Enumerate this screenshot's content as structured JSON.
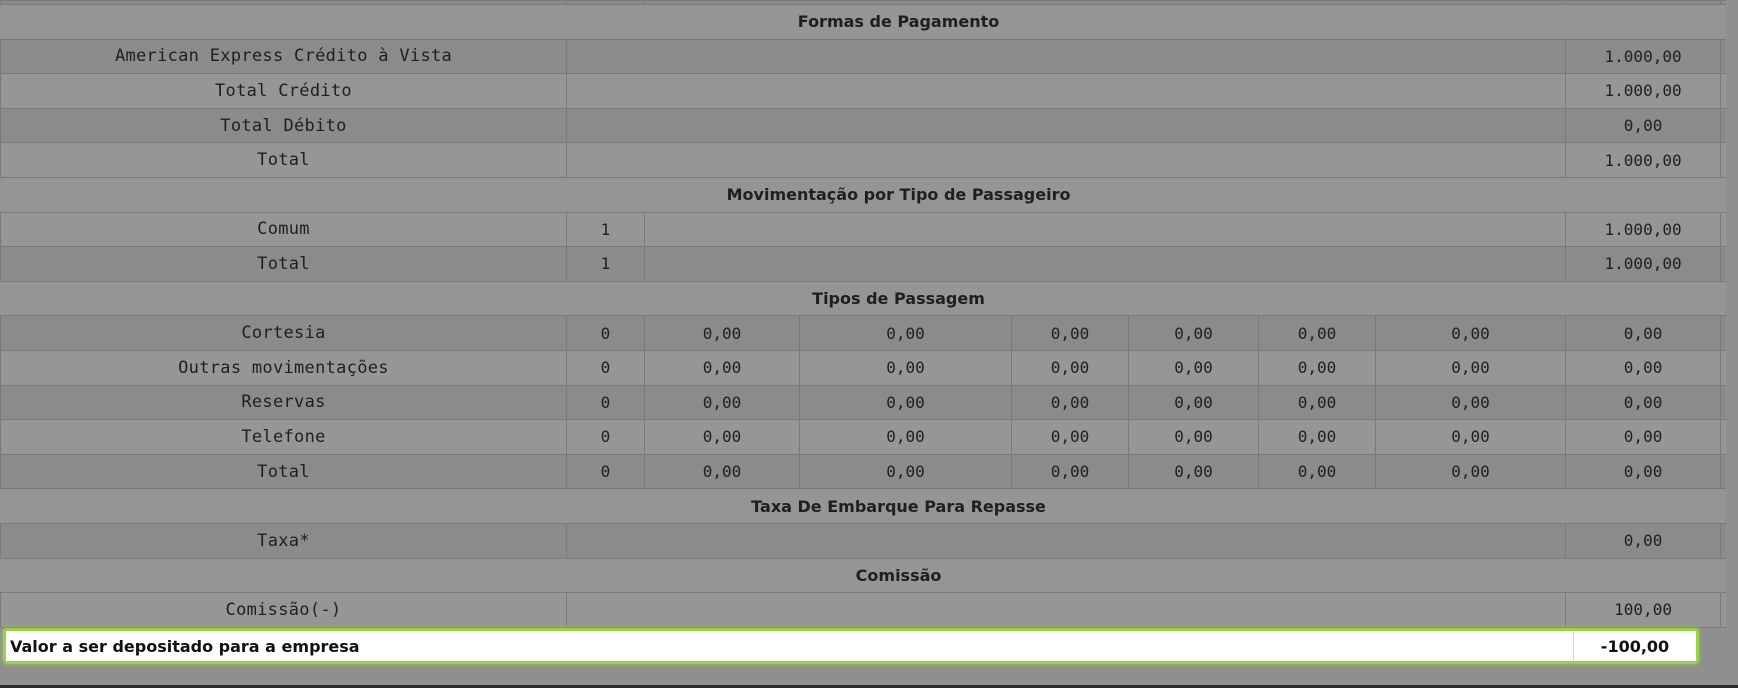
{
  "sections": {
    "pagamento": {
      "title": "Formas de Pagamento",
      "rows": [
        {
          "label": "American Express Crédito à Vista",
          "total": "1.000,00"
        },
        {
          "label": "Total Crédito",
          "total": "1.000,00"
        },
        {
          "label": "Total Débito",
          "total": "0,00"
        },
        {
          "label": "Total",
          "total": "1.000,00"
        }
      ]
    },
    "passageiro": {
      "title": "Movimentação por Tipo de Passageiro",
      "rows": [
        {
          "label": "Comum",
          "qty": "1",
          "total": "1.000,00"
        },
        {
          "label": "Total",
          "qty": "1",
          "total": "1.000,00"
        }
      ]
    },
    "passagem": {
      "title": "Tipos de Passagem",
      "rows": [
        {
          "label": "Cortesia",
          "values": [
            "0",
            "0,00",
            "0,00",
            "0,00",
            "0,00",
            "0,00",
            "0,00",
            "0,00"
          ]
        },
        {
          "label": "Outras movimentações",
          "values": [
            "0",
            "0,00",
            "0,00",
            "0,00",
            "0,00",
            "0,00",
            "0,00",
            "0,00"
          ]
        },
        {
          "label": "Reservas",
          "values": [
            "0",
            "0,00",
            "0,00",
            "0,00",
            "0,00",
            "0,00",
            "0,00",
            "0,00"
          ]
        },
        {
          "label": "Telefone",
          "values": [
            "0",
            "0,00",
            "0,00",
            "0,00",
            "0,00",
            "0,00",
            "0,00",
            "0,00"
          ]
        },
        {
          "label": "Total",
          "values": [
            "0",
            "0,00",
            "0,00",
            "0,00",
            "0,00",
            "0,00",
            "0,00",
            "0,00"
          ]
        }
      ]
    },
    "taxa": {
      "title": "Taxa De Embarque Para Repasse",
      "rows": [
        {
          "label": "Taxa*",
          "total": "0,00"
        }
      ]
    },
    "comissao": {
      "title": "Comissão",
      "rows": [
        {
          "label": "Comissão(-)",
          "total": "100,00"
        }
      ]
    }
  },
  "deposit": {
    "label": "Valor a ser depositado para a empresa",
    "value": "-100,00"
  },
  "colors": {
    "background": "#8f8f8f",
    "highlight_border": "#9bd14a",
    "highlight_fill": "#ffffff"
  }
}
